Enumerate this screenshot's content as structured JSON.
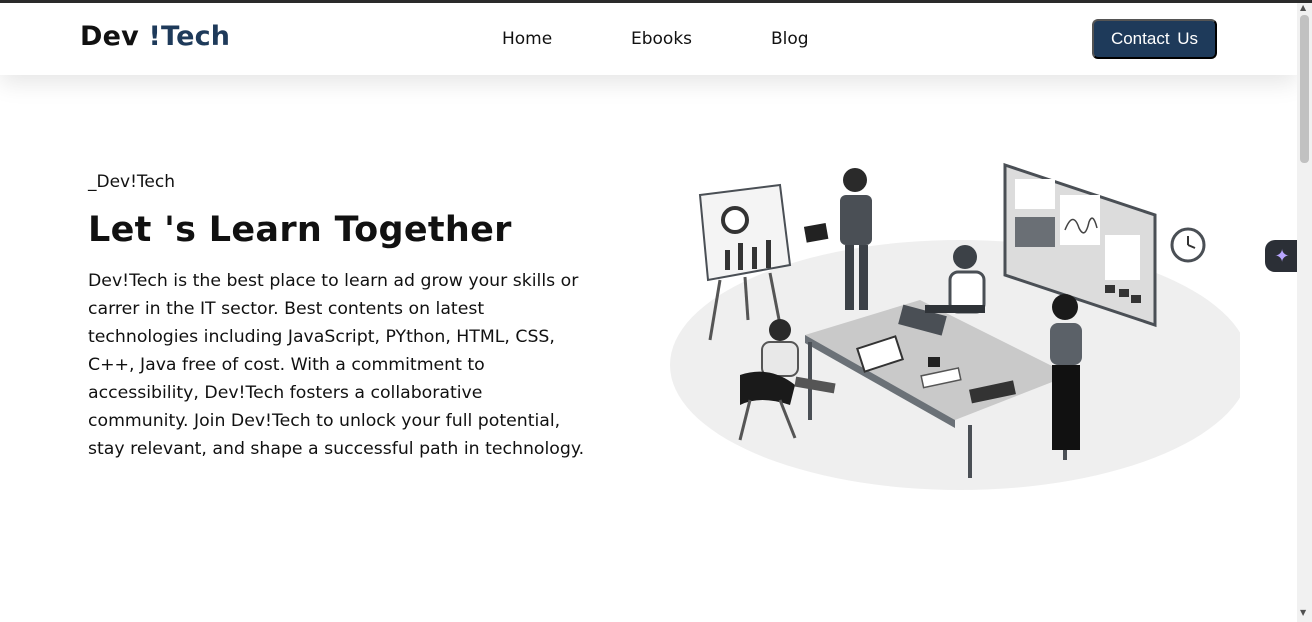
{
  "brand": {
    "part1": "Dev ",
    "part2": "!Tech"
  },
  "nav": {
    "home": "Home",
    "ebooks": "Ebooks",
    "blog": "Blog",
    "contact": "Contact Us"
  },
  "hero": {
    "eyebrow": "_Dev!Tech",
    "title": "Let 's Learn Together",
    "description": "Dev!Tech is the best place to learn ad grow your skills or carrer in the IT sector. Best contents on latest technologies including JavaScript, PYthon, HTML, CSS, C++, Java free of cost. With a commitment to accessibility, Dev!Tech fosters a collaborative community. Join Dev!Tech to unlock your full potential, stay relevant, and shape a successful path in technology."
  },
  "colors": {
    "brand_accent": "#1e3a5a",
    "text": "#111111",
    "background": "#ffffff"
  },
  "icons": {
    "floating_button": "sparkle-icon",
    "scroll_up": "arrow-up-icon",
    "scroll_down": "arrow-down-icon"
  }
}
